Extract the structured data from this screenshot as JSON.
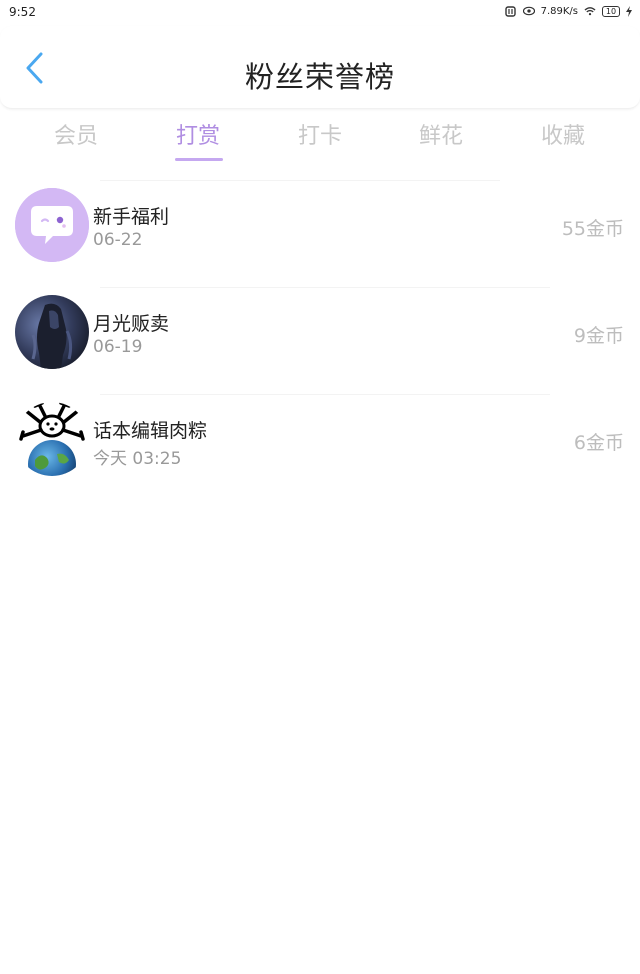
{
  "status_bar": {
    "time": "9:52",
    "network_speed": "7.89K/s",
    "battery": "10",
    "icons": [
      "nfc-icon",
      "eye-icon",
      "wifi-icon",
      "battery-icon",
      "charging-icon"
    ]
  },
  "header": {
    "title": "粉丝荣誉榜",
    "back_icon": "chevron-left-icon"
  },
  "tabs": [
    {
      "label": "会员",
      "active": false
    },
    {
      "label": "打赏",
      "active": true
    },
    {
      "label": "打卡",
      "active": false
    },
    {
      "label": "鲜花",
      "active": false
    },
    {
      "label": "收藏",
      "active": false
    }
  ],
  "list": [
    {
      "name": "新手福利",
      "date": "06-22",
      "reward": "55金币",
      "avatar": "chat-bubble-icon"
    },
    {
      "name": "月光贩卖",
      "date": "06-19",
      "reward": "9金币",
      "avatar": "user-avatar-dark"
    },
    {
      "name": "话本编辑肉粽",
      "date": "今天 03:25",
      "reward": "6金币",
      "avatar": "user-avatar-earth"
    }
  ],
  "colors": {
    "accent": "#b08ee2",
    "accent_underline": "#c5a8f0",
    "inactive_tab": "#c8c8c8",
    "muted_text": "#999999",
    "reward_text": "#bdbdbd",
    "back_arrow": "#4aa8f0"
  }
}
